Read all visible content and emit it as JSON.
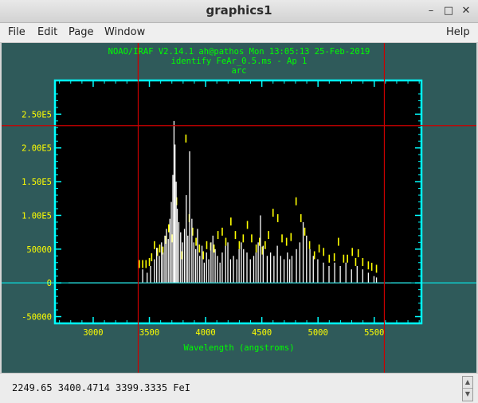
{
  "window": {
    "title": "graphics1",
    "min_glyph": "–",
    "max_glyph": "□",
    "close_glyph": "✕"
  },
  "menu": {
    "file": "File",
    "edit": "Edit",
    "page": "Page",
    "window": "Window",
    "help": "Help"
  },
  "plot": {
    "header_line1": "NOAO/IRAF V2.14.1 ah@pathos Mon 13:05:13 25-Feb-2019",
    "header_line2": "identify FeAr_0.5.ms - Ap 1",
    "header_line3": "arc",
    "xlabel": "Wavelength (angstroms)",
    "colors": {
      "background": "#000000",
      "frame": "#00ffff",
      "spectrum": "#ffffff",
      "markers": "#ffff00",
      "cursor": "#cc0000",
      "text": "#00ff00"
    }
  },
  "chart_data": {
    "type": "line",
    "title": "NOAO/IRAF V2.14.1 ah@pathos Mon 13:05:13 25-Feb-2019",
    "xlabel": "Wavelength (angstroms)",
    "ylabel": "",
    "xlim": [
      2660,
      5920
    ],
    "ylim": [
      -60000,
      300000
    ],
    "xticks": [
      3000,
      3500,
      4000,
      4500,
      5000,
      5500
    ],
    "xtick_labels": [
      "3000",
      "3500",
      "4000",
      "4500",
      "5000",
      "5500"
    ],
    "yticks": [
      -50000,
      0,
      50000,
      100000,
      150000,
      200000,
      250000
    ],
    "ytick_labels": [
      "-50000",
      "0",
      "50000",
      "1.00E5",
      "1.50E5",
      "2.00E5",
      "2.50E5"
    ],
    "cursor": {
      "x": 3400.47,
      "y": 233000
    },
    "spectrum_lines": [
      [
        3440,
        20000
      ],
      [
        3480,
        15000
      ],
      [
        3510,
        25000
      ],
      [
        3545,
        35000
      ],
      [
        3565,
        52000
      ],
      [
        3588,
        40000
      ],
      [
        3608,
        60000
      ],
      [
        3622,
        45000
      ],
      [
        3638,
        70000
      ],
      [
        3652,
        80000
      ],
      [
        3668,
        65000
      ],
      [
        3682,
        95000
      ],
      [
        3695,
        120000
      ],
      [
        3709,
        160000
      ],
      [
        3719,
        240000
      ],
      [
        3728,
        205000
      ],
      [
        3738,
        150000
      ],
      [
        3748,
        110000
      ],
      [
        3762,
        90000
      ],
      [
        3778,
        75000
      ],
      [
        3795,
        60000
      ],
      [
        3812,
        80000
      ],
      [
        3828,
        130000
      ],
      [
        3842,
        70000
      ],
      [
        3858,
        195000
      ],
      [
        3878,
        95000
      ],
      [
        3895,
        60000
      ],
      [
        3912,
        50000
      ],
      [
        3928,
        80000
      ],
      [
        3948,
        40000
      ],
      [
        3968,
        55000
      ],
      [
        3988,
        30000
      ],
      [
        4008,
        45000
      ],
      [
        4028,
        35000
      ],
      [
        4048,
        60000
      ],
      [
        4065,
        70000
      ],
      [
        4085,
        50000
      ],
      [
        4105,
        40000
      ],
      [
        4128,
        30000
      ],
      [
        4148,
        45000
      ],
      [
        4178,
        55000
      ],
      [
        4198,
        60000
      ],
      [
        4222,
        35000
      ],
      [
        4248,
        40000
      ],
      [
        4278,
        35000
      ],
      [
        4298,
        50000
      ],
      [
        4318,
        60000
      ],
      [
        4338,
        50000
      ],
      [
        4368,
        45000
      ],
      [
        4398,
        35000
      ],
      [
        4428,
        40000
      ],
      [
        4448,
        45000
      ],
      [
        4468,
        60000
      ],
      [
        4488,
        100000
      ],
      [
        4512,
        55000
      ],
      [
        4548,
        40000
      ],
      [
        4578,
        45000
      ],
      [
        4608,
        40000
      ],
      [
        4638,
        55000
      ],
      [
        4668,
        40000
      ],
      [
        4698,
        35000
      ],
      [
        4728,
        45000
      ],
      [
        4748,
        35000
      ],
      [
        4768,
        40000
      ],
      [
        4808,
        50000
      ],
      [
        4838,
        60000
      ],
      [
        4868,
        90000
      ],
      [
        4898,
        70000
      ],
      [
        4928,
        50000
      ],
      [
        4958,
        40000
      ],
      [
        4998,
        35000
      ],
      [
        5048,
        30000
      ],
      [
        5098,
        25000
      ],
      [
        5148,
        30000
      ],
      [
        5198,
        25000
      ],
      [
        5248,
        30000
      ],
      [
        5298,
        20000
      ],
      [
        5348,
        25000
      ],
      [
        5398,
        20000
      ],
      [
        5448,
        15000
      ],
      [
        5498,
        10000
      ],
      [
        5520,
        8000
      ]
    ],
    "identified_lines": [
      [
        3410,
        22000
      ],
      [
        3440,
        22000
      ],
      [
        3470,
        22000
      ],
      [
        3500,
        25000
      ],
      [
        3520,
        32000
      ],
      [
        3545,
        50000
      ],
      [
        3572,
        40000
      ],
      [
        3592,
        45000
      ],
      [
        3620,
        42000
      ],
      [
        3645,
        58000
      ],
      [
        3672,
        75000
      ],
      [
        3700,
        60000
      ],
      [
        3742,
        115000
      ],
      [
        3790,
        35000
      ],
      [
        3825,
        208000
      ],
      [
        3855,
        90000
      ],
      [
        3885,
        70000
      ],
      [
        3915,
        55000
      ],
      [
        3945,
        45000
      ],
      [
        3980,
        35000
      ],
      [
        4010,
        50000
      ],
      [
        4045,
        48000
      ],
      [
        4075,
        45000
      ],
      [
        4110,
        65000
      ],
      [
        4148,
        70000
      ],
      [
        4180,
        55000
      ],
      [
        4225,
        85000
      ],
      [
        4265,
        65000
      ],
      [
        4300,
        50000
      ],
      [
        4335,
        60000
      ],
      [
        4372,
        80000
      ],
      [
        4410,
        60000
      ],
      [
        4450,
        45000
      ],
      [
        4480,
        55000
      ],
      [
        4505,
        42000
      ],
      [
        4530,
        50000
      ],
      [
        4560,
        65000
      ],
      [
        4600,
        98000
      ],
      [
        4642,
        90000
      ],
      [
        4680,
        60000
      ],
      [
        4720,
        55000
      ],
      [
        4760,
        62000
      ],
      [
        4805,
        115000
      ],
      [
        4848,
        90000
      ],
      [
        4882,
        70000
      ],
      [
        4925,
        50000
      ],
      [
        4968,
        35000
      ],
      [
        5010,
        45000
      ],
      [
        5050,
        40000
      ],
      [
        5100,
        30000
      ],
      [
        5145,
        32000
      ],
      [
        5182,
        55000
      ],
      [
        5228,
        30000
      ],
      [
        5262,
        30000
      ],
      [
        5305,
        40000
      ],
      [
        5335,
        25000
      ],
      [
        5358,
        38000
      ],
      [
        5398,
        25000
      ],
      [
        5448,
        20000
      ],
      [
        5478,
        18000
      ],
      [
        5520,
        15000
      ]
    ]
  },
  "status": {
    "coords": "2249.65  3400.4714  3399.3335 FeI"
  }
}
